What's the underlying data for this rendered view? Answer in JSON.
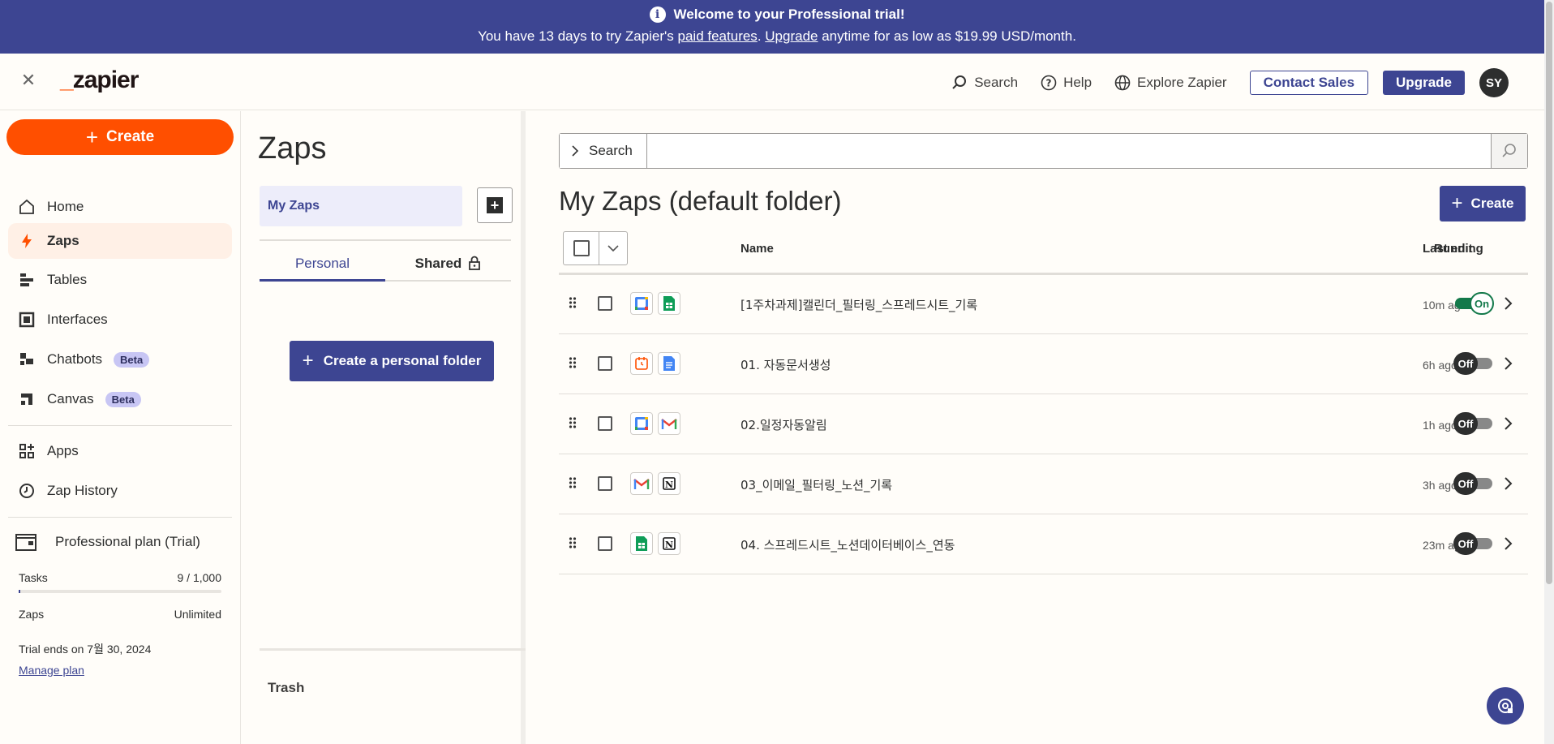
{
  "banner": {
    "title": "Welcome to your Professional trial!",
    "line_prefix": "You have 13 days to try Zapier's ",
    "paid_features": "paid features",
    "period": ". ",
    "upgrade": "Upgrade",
    "line_suffix": " anytime for as low as $19.99 USD/month."
  },
  "topbar": {
    "logo_underscore": "_",
    "logo_text": "zapier",
    "search": "Search",
    "help": "Help",
    "explore": "Explore Zapier",
    "contact_sales": "Contact Sales",
    "upgrade": "Upgrade",
    "avatar_initials": "SY"
  },
  "sidebar": {
    "create": "Create",
    "items": [
      {
        "label": "Home"
      },
      {
        "label": "Zaps"
      },
      {
        "label": "Tables"
      },
      {
        "label": "Interfaces"
      },
      {
        "label": "Chatbots",
        "badge": "Beta"
      },
      {
        "label": "Canvas",
        "badge": "Beta"
      },
      {
        "label": "Apps"
      },
      {
        "label": "Zap History"
      }
    ],
    "plan": {
      "title": "Professional plan (Trial)",
      "tasks_label": "Tasks",
      "tasks_value": "9 / 1,000",
      "tasks_fraction": 0.009,
      "zaps_label": "Zaps",
      "zaps_value": "Unlimited",
      "trial_ends": "Trial ends on 7월 30, 2024",
      "manage": "Manage plan"
    }
  },
  "folders": {
    "title": "Zaps",
    "my_zaps": "My Zaps",
    "tab_personal": "Personal",
    "tab_shared": "Shared",
    "create_folder": "Create a personal folder",
    "trash": "Trash"
  },
  "main": {
    "search_label": "Search",
    "search_value": "",
    "title": "My Zaps (default folder)",
    "create": "Create",
    "columns": {
      "name": "Name",
      "last_edit": "Last edit",
      "running": "Running"
    },
    "rows": [
      {
        "name": "[1주차과제]캘린더_필터링_스프레드시트_기록",
        "last_edit": "10m ago",
        "status": "On",
        "apps": [
          "google-calendar",
          "google-sheets"
        ]
      },
      {
        "name": "01. 자동문서생성",
        "last_edit": "6h ago",
        "status": "Off",
        "apps": [
          "schedule",
          "google-docs"
        ]
      },
      {
        "name": "02.일정자동알림",
        "last_edit": "1h ago",
        "status": "Off",
        "apps": [
          "google-calendar",
          "gmail"
        ]
      },
      {
        "name": "03_이메일_필터링_노션_기록",
        "last_edit": "3h ago",
        "status": "Off",
        "apps": [
          "gmail",
          "notion"
        ]
      },
      {
        "name": "04. 스프레드시트_노션데이터베이스_연동",
        "last_edit": "23m ago",
        "status": "Off",
        "apps": [
          "google-sheets",
          "notion"
        ]
      }
    ]
  },
  "colors": {
    "brand_orange": "#ff4f00",
    "accent_purple": "#3d4592",
    "on_green": "#13794a"
  }
}
